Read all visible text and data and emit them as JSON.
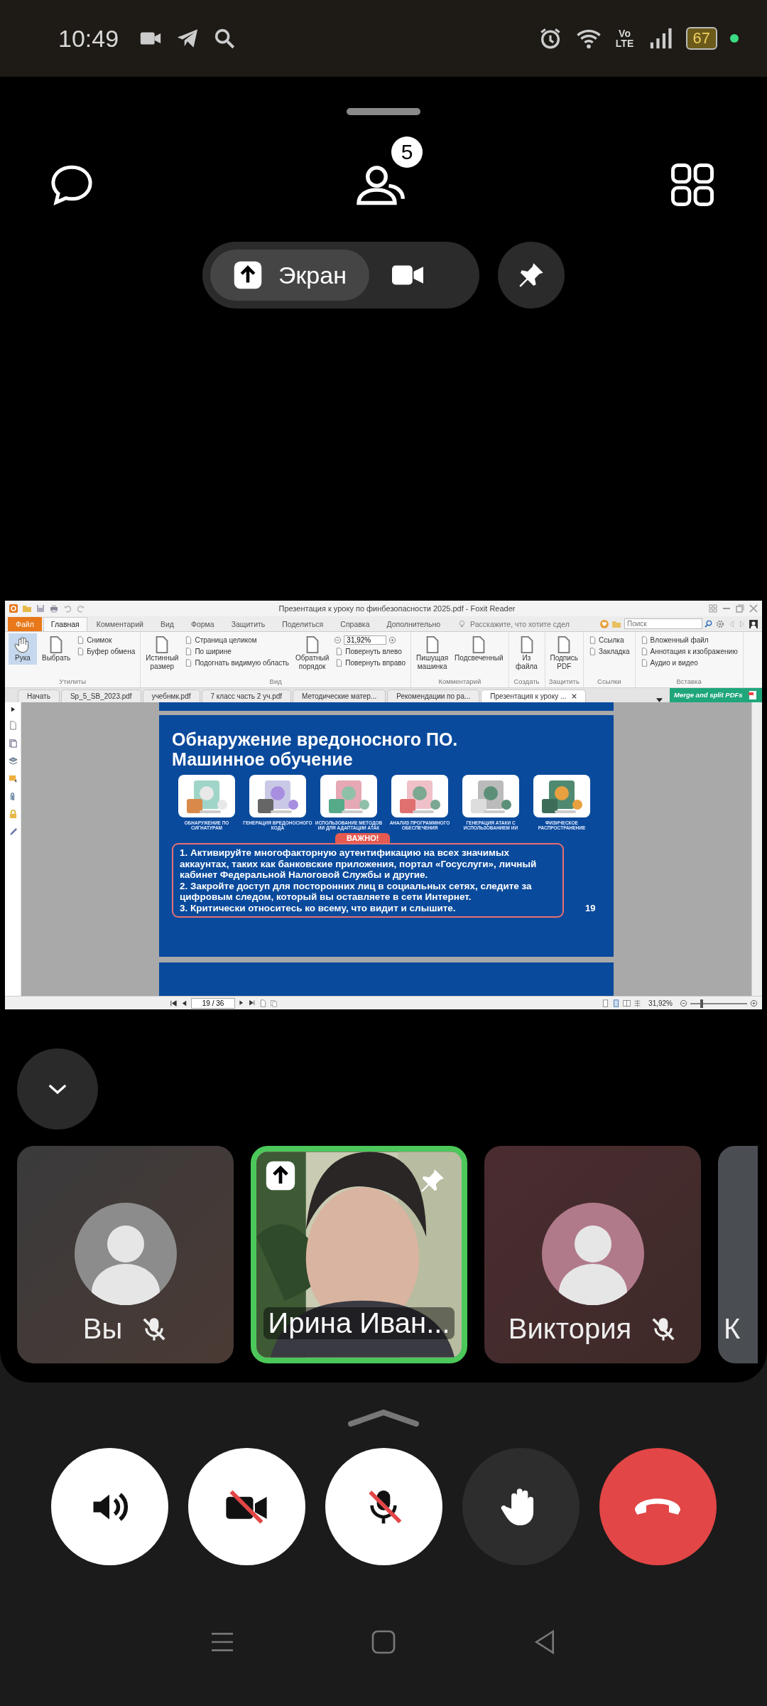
{
  "status_bar": {
    "time": "10:49",
    "network_label": "Vo LTE",
    "battery": "67"
  },
  "call_header": {
    "participants_count": "5"
  },
  "share_switch": [
    {
      "kind": "screen",
      "label": "Экран",
      "selected": true
    },
    {
      "kind": "camera",
      "selected": false
    }
  ],
  "shared_screen": {
    "window_title": "Презентация к уроку по финбезопасности 2025.pdf - Foxit Reader",
    "menu_tabs": [
      {
        "label": "Файл",
        "kind": "file",
        "selected": false
      },
      {
        "label": "Главная",
        "kind": "tab",
        "selected": true
      },
      {
        "label": "Комментарий",
        "kind": "tab",
        "selected": false
      },
      {
        "label": "Вид",
        "kind": "tab",
        "selected": false
      },
      {
        "label": "Форма",
        "kind": "tab",
        "selected": false
      },
      {
        "label": "Защитить",
        "kind": "tab",
        "selected": false
      },
      {
        "label": "Поделиться",
        "kind": "tab",
        "selected": false
      },
      {
        "label": "Справка",
        "kind": "tab",
        "selected": false
      },
      {
        "label": "Дополнительно",
        "kind": "tab",
        "selected": false
      }
    ],
    "tell_me": {
      "placeholder": "Расскажите, что хотите сдел"
    },
    "search": {
      "placeholder": "Поиск"
    },
    "ribbon_groups": [
      {
        "label": "Утилиты",
        "items": [
          {
            "kind": "large",
            "label": "Рука",
            "selected": true
          },
          {
            "kind": "large",
            "label": "Выбрать",
            "selected": false
          },
          {
            "kind": "small",
            "label": "Снимок",
            "selected": false
          },
          {
            "kind": "small",
            "label": "Буфер обмена",
            "selected": false
          }
        ]
      },
      {
        "label": "Вид",
        "items": [
          {
            "kind": "large",
            "label": "Истинный размер",
            "selected": false
          },
          {
            "kind": "small",
            "label": "Страница целиком",
            "selected": false
          },
          {
            "kind": "small",
            "label": "По ширине",
            "selected": false
          },
          {
            "kind": "small",
            "label": "Подогнать видимую область",
            "selected": false
          },
          {
            "kind": "large",
            "label": "Обратный порядок",
            "selected": false
          },
          {
            "kind": "zoom",
            "value": "31,92%"
          },
          {
            "kind": "small",
            "label": "Повернуть влево",
            "selected": false
          },
          {
            "kind": "small",
            "label": "Повернуть вправо",
            "selected": false
          }
        ]
      },
      {
        "label": "Комментарий",
        "items": [
          {
            "kind": "large",
            "label": "Пишущая машинка",
            "selected": false
          },
          {
            "kind": "large",
            "label": "Подсвеченный",
            "selected": false
          }
        ]
      },
      {
        "label": "Создать",
        "items": [
          {
            "kind": "large",
            "label": "Из файла",
            "selected": false
          }
        ]
      },
      {
        "label": "Защитить",
        "items": [
          {
            "kind": "large",
            "label": "Подпись PDF",
            "selected": false
          }
        ]
      },
      {
        "label": "Ссылки",
        "items": [
          {
            "kind": "small",
            "label": "Ссылка",
            "selected": false
          },
          {
            "kind": "small",
            "label": "Закладка",
            "selected": false
          }
        ]
      },
      {
        "label": "Вставка",
        "items": [
          {
            "kind": "small",
            "label": "Вложенный файл",
            "selected": false
          },
          {
            "kind": "small",
            "label": "Аннотация к изображению",
            "selected": false
          },
          {
            "kind": "small",
            "label": "Аудио и видео",
            "selected": false
          }
        ]
      }
    ],
    "doc_tabs": [
      {
        "label": "Начать",
        "selected": false
      },
      {
        "label": "Sp_5_SB_2023.pdf",
        "selected": false
      },
      {
        "label": "учебнмк.pdf",
        "selected": false
      },
      {
        "label": "7 класс часть 2 уч.pdf",
        "selected": false
      },
      {
        "label": "Методические матер...",
        "selected": false
      },
      {
        "label": "Рекомендации по ра...",
        "selected": false
      },
      {
        "label": "Презентация к уроку ...",
        "selected": true
      }
    ],
    "promo": "Merge and split PDFs",
    "slide": {
      "title_lines": [
        "Обнаружение вредоносного ПО.",
        "Машинное обучение"
      ],
      "cards": [
        {
          "caption": "ОБНАРУЖЕНИЕ ПО СИГНАТУРАМ"
        },
        {
          "caption": "ГЕНЕРАЦИЯ ВРЕДОНОСНОГО КОДА"
        },
        {
          "caption": "ИСПОЛЬЗОВАНИЕ МЕТОДОВ ИИ ДЛЯ АДАПТАЦИИ АТАК"
        },
        {
          "caption": "АНАЛИЗ ПРОГРАММНОГО ОБЕСПЕЧЕНИЯ"
        },
        {
          "caption": "ГЕНЕРАЦИЯ АТАКИ С ИСПОЛЬЗОВАНИЕМ ИИ"
        },
        {
          "caption": "ФИЗИЧЕСКОЕ РАСПРОСТРАНЕНИЕ"
        }
      ],
      "notice_label": "ВАЖНО!",
      "notice_items": [
        "1. Активируйте многофакторную аутентификацию на всех значимых аккаунтах, таких как банковские приложения, портал «Госуслуги», личный кабинет Федеральной Налоговой Службы и другие.",
        "2. Закройте доступ для посторонних лиц в социальных сетях, следите за цифровым следом, который вы оставляете в сети Интернет.",
        "3. Критически относитесь ко всему, что видит и слышите."
      ],
      "page_number": "19"
    },
    "page_field": "19 / 36",
    "zoom_level": "31,92%",
    "zoom_slider": {
      "level": 0.2
    }
  },
  "participants": [
    {
      "name": "Вы",
      "kind": "avatar",
      "muted": true,
      "pinned": false,
      "sharing": false,
      "active": false
    },
    {
      "name": "Ирина Иван...",
      "kind": "video",
      "muted": false,
      "pinned": true,
      "sharing": true,
      "active": true
    },
    {
      "name": "Виктория",
      "kind": "avatar",
      "muted": true,
      "pinned": false,
      "sharing": false,
      "active": false
    },
    {
      "name": "К",
      "kind": "cropped",
      "muted": false,
      "pinned": false,
      "sharing": false,
      "active": false
    }
  ],
  "controls": [
    {
      "kind": "speaker",
      "on": true
    },
    {
      "kind": "camera",
      "on": false
    },
    {
      "kind": "mic",
      "on": false
    },
    {
      "kind": "hand",
      "on": false
    },
    {
      "kind": "hangup"
    }
  ]
}
